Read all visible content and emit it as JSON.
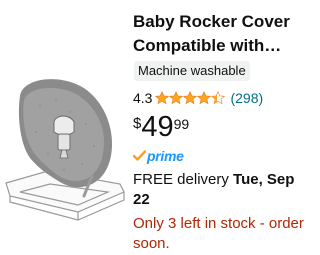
{
  "product": {
    "title_line1": "Baby Rocker Cover",
    "title_line2": "Compatible with…",
    "badge": "Machine washable",
    "rating": "4.3",
    "stars": 4.3,
    "review_count": "(298)",
    "price": {
      "symbol": "$",
      "whole": "49",
      "fraction": "99"
    },
    "prime_label": "prime",
    "delivery": {
      "prefix": "FREE delivery ",
      "date": "Tue, Sep 22"
    },
    "stock_message": "Only 3 left in stock - order soon."
  },
  "image": {
    "icon": "baby-rocker-product-image"
  },
  "colors": {
    "star": "#ffa41c",
    "link": "#007185",
    "prime": "#1a98ff",
    "stock": "#b12704",
    "badge_bg": "#f0f2f2"
  }
}
